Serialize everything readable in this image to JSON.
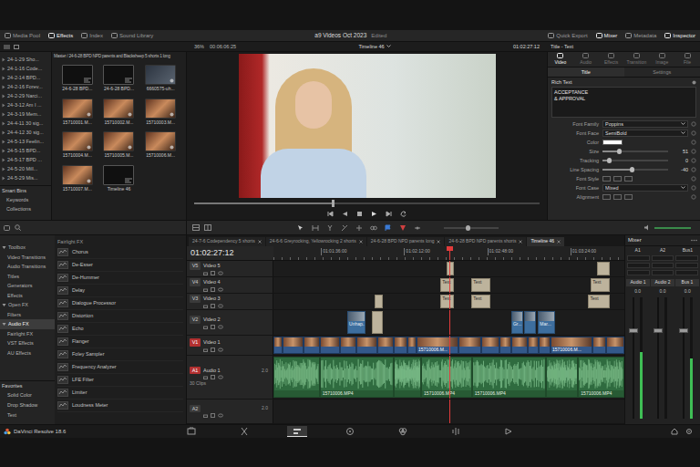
{
  "topbar": {
    "left": [
      {
        "label": "Media Pool",
        "selected": false
      },
      {
        "label": "Effects",
        "selected": true
      },
      {
        "label": "Index",
        "selected": false
      },
      {
        "label": "Sound Library",
        "selected": false
      }
    ],
    "project": "a9 Videos Oct 2023",
    "status": "Edited",
    "right": [
      {
        "label": "Quick Export",
        "selected": false
      },
      {
        "label": "Mixer",
        "selected": true
      },
      {
        "label": "Metadata",
        "selected": false
      },
      {
        "label": "Inspector",
        "selected": true
      }
    ]
  },
  "subbar": {
    "zoom": "36%",
    "duration": "00:06:06:25",
    "timeline": "Timeline 46",
    "timecode": "01:02:27:12",
    "inspector_title": "Title - Text"
  },
  "bins": {
    "items": [
      "24-1-29 Sho...",
      "24-1-16 Code...",
      "24-2-14 BPD...",
      "24-2-16 Forev...",
      "24-2-29 Narci...",
      "24-3-12 Am I ...",
      "24-3-19 Mem...",
      "24-4-11 30 sig...",
      "24-4-12 30 sig...",
      "24-5-13 Feelin...",
      "24-5-15 BPD...",
      "24-5-17 BPD ...",
      "24-5-20 Mill...",
      "24-5-29 Mis..."
    ],
    "smart_title": "Smart Bins",
    "smart_items": [
      "Keywords",
      "Collections"
    ]
  },
  "media_pool": {
    "path": "Master / 24-6-28 BPD NPD parents and Blacksheep 5 shorts 1 long",
    "clips": [
      {
        "label": "24-6-28 BPD...",
        "kind": "timeline"
      },
      {
        "label": "24-6-28 BPD...",
        "kind": "timeline"
      },
      {
        "label": "6660575-uh...",
        "kind": "stock"
      },
      {
        "label": "15710001.M...",
        "kind": "clip"
      },
      {
        "label": "15710002.M...",
        "kind": "clip"
      },
      {
        "label": "15710003.M...",
        "kind": "clip"
      },
      {
        "label": "15710004.M...",
        "kind": "clip"
      },
      {
        "label": "15710005.M...",
        "kind": "clip"
      },
      {
        "label": "15710006.M...",
        "kind": "clip"
      },
      {
        "label": "15710007.M...",
        "kind": "clip"
      },
      {
        "label": "Timeline 46",
        "kind": "timeline"
      }
    ]
  },
  "viewer": {
    "scrub_level": 0.4
  },
  "inspector": {
    "tabs": [
      {
        "label": "Video",
        "selected": true
      },
      {
        "label": "Audio",
        "selected": false
      },
      {
        "label": "Effects",
        "selected": false
      },
      {
        "label": "Transition",
        "selected": false
      },
      {
        "label": "Image",
        "selected": false
      },
      {
        "label": "File",
        "selected": false
      }
    ],
    "subtabs": [
      {
        "label": "Title",
        "selected": true
      },
      {
        "label": "Settings",
        "selected": false
      }
    ],
    "section": "Rich Text",
    "text": "ACCEPTANCE\n& APPROVAL",
    "props": [
      {
        "label": "Font Family",
        "kind": "select",
        "value": "Poppins"
      },
      {
        "label": "Font Face",
        "kind": "select",
        "value": "SemiBold"
      },
      {
        "label": "Color",
        "kind": "color",
        "color": "#ffffff"
      },
      {
        "label": "Size",
        "kind": "slider",
        "value": "51",
        "level": 0.25
      },
      {
        "label": "Tracking",
        "kind": "slider",
        "value": "0",
        "level": 0.1
      },
      {
        "label": "Line Spacing",
        "kind": "slider",
        "value": "-40",
        "level": 0.45
      },
      {
        "label": "Font Style",
        "kind": "buttons"
      },
      {
        "label": "Font Case",
        "kind": "select",
        "value": "Mixed"
      },
      {
        "label": "Alignment",
        "kind": "buttons"
      }
    ]
  },
  "effects": {
    "categories": [
      {
        "label": "Toolbox",
        "kind": "group",
        "expanded": true,
        "selected": false
      },
      {
        "label": "Video Transitions",
        "kind": "item",
        "selected": false
      },
      {
        "label": "Audio Transitions",
        "kind": "item",
        "selected": false
      },
      {
        "label": "Titles",
        "kind": "item",
        "selected": false
      },
      {
        "label": "Generators",
        "kind": "item",
        "selected": false
      },
      {
        "label": "Effects",
        "kind": "item",
        "selected": false
      },
      {
        "label": "Open FX",
        "kind": "group",
        "expanded": true,
        "selected": false
      },
      {
        "label": "Filters",
        "kind": "item",
        "selected": false
      },
      {
        "label": "Audio FX",
        "kind": "group",
        "expanded": true,
        "selected": true
      },
      {
        "label": "Fairlight FX",
        "kind": "item",
        "selected": false
      },
      {
        "label": "VST Effects",
        "kind": "item",
        "selected": false
      },
      {
        "label": "AU Effects",
        "kind": "item",
        "selected": false
      }
    ],
    "favorites_title": "Favorites",
    "favorites": [
      "Solid Color",
      "Drop Shadow",
      "Text"
    ],
    "list_title": "Fairlight FX",
    "list": [
      "Chorus",
      "De-Esser",
      "De-Hummer",
      "Delay",
      "Dialogue Processor",
      "Distortion",
      "Echo",
      "Flanger",
      "Foley Sampler",
      "Frequency Analyzer",
      "LFE Filter",
      "Limiter",
      "Loudness Meter"
    ]
  },
  "timeline": {
    "tabs": [
      {
        "label": "24-7-6 Codependency 5 shorts",
        "selected": false
      },
      {
        "label": "24-6-6 Greyrocking, Yellowrocking 2 shorts",
        "selected": false
      },
      {
        "label": "24-6-28 BPD NPD parents long",
        "selected": false
      },
      {
        "label": "24-6-28 BPD NPD parents shorts",
        "selected": false
      },
      {
        "label": "Timeline 46",
        "selected": true
      }
    ],
    "timecode": "01:02:27:12",
    "span_s": 152,
    "playhead_s": 76,
    "ruler": [
      {
        "label": "01:01:36:00",
        "at": 20.6
      },
      {
        "label": "01:02:12:00",
        "at": 56.6
      },
      {
        "label": "01:02:48:00",
        "at": 92.6
      },
      {
        "label": "01:03:24:00",
        "at": 128.6
      }
    ],
    "tracks": [
      {
        "id": "V5",
        "name": "Video 5",
        "kind": "video",
        "selected": false,
        "clips": [
          {
            "start": 75,
            "end": 78.3,
            "kind": "title"
          },
          {
            "start": 140,
            "end": 145.5,
            "kind": "title"
          }
        ]
      },
      {
        "id": "V4",
        "name": "Video 4",
        "kind": "video",
        "selected": false,
        "clips": [
          {
            "start": 72.3,
            "end": 78.3,
            "kind": "title",
            "label": "Text"
          },
          {
            "start": 85.8,
            "end": 94,
            "kind": "title",
            "label": "Text"
          },
          {
            "start": 137.5,
            "end": 145.5,
            "kind": "title",
            "label": "Text"
          }
        ]
      },
      {
        "id": "V3",
        "name": "Video 3",
        "kind": "video",
        "selected": false,
        "clips": [
          {
            "start": 43.9,
            "end": 47.4,
            "kind": "title"
          },
          {
            "start": 72.3,
            "end": 78.3,
            "kind": "title",
            "label": "Text"
          },
          {
            "start": 85.8,
            "end": 94,
            "kind": "title",
            "label": "Text"
          },
          {
            "start": 136.4,
            "end": 145.5,
            "kind": "title",
            "label": "Text"
          }
        ]
      },
      {
        "id": "V2",
        "name": "Video 2",
        "kind": "video",
        "selected": false,
        "clips": [
          {
            "start": 32,
            "end": 40,
            "kind": "video",
            "label": "Unhap..."
          },
          {
            "start": 42.7,
            "end": 47.4,
            "kind": "title"
          },
          {
            "start": 103,
            "end": 108,
            "kind": "video",
            "label": "Gr..."
          },
          {
            "start": 108.7,
            "end": 113.8,
            "kind": "video"
          },
          {
            "start": 114.6,
            "end": 122,
            "kind": "video",
            "label": "Mar..."
          }
        ]
      },
      {
        "id": "V1",
        "name": "Video 1",
        "kind": "video",
        "selected": true,
        "clips": [
          {
            "start": 0,
            "end": 4,
            "kind": "main"
          },
          {
            "start": 4,
            "end": 13,
            "kind": "main"
          },
          {
            "start": 13,
            "end": 20,
            "kind": "main"
          },
          {
            "start": 20,
            "end": 29,
            "kind": "main"
          },
          {
            "start": 29,
            "end": 36,
            "kind": "main"
          },
          {
            "start": 36,
            "end": 45,
            "kind": "main"
          },
          {
            "start": 45,
            "end": 52,
            "kind": "main"
          },
          {
            "start": 52,
            "end": 58,
            "kind": "main"
          },
          {
            "start": 58,
            "end": 62,
            "kind": "main"
          },
          {
            "start": 62,
            "end": 80,
            "kind": "main",
            "label": "15710006.M..."
          },
          {
            "start": 80,
            "end": 90,
            "kind": "main"
          },
          {
            "start": 90,
            "end": 98,
            "kind": "main"
          },
          {
            "start": 98,
            "end": 103,
            "kind": "main"
          },
          {
            "start": 103,
            "end": 110,
            "kind": "main"
          },
          {
            "start": 110,
            "end": 115,
            "kind": "main"
          },
          {
            "start": 115,
            "end": 120,
            "kind": "main"
          },
          {
            "start": 120,
            "end": 138,
            "kind": "main",
            "label": "15710006.M..."
          },
          {
            "start": 138,
            "end": 144,
            "kind": "main"
          },
          {
            "start": 144,
            "end": 152,
            "kind": "main"
          }
        ]
      },
      {
        "id": "A1",
        "name": "Audio 1",
        "kind": "audio",
        "channels": "2.0",
        "count": "30 Clips",
        "selected": true,
        "clips": [
          {
            "start": 0,
            "end": 20,
            "kind": "audio"
          },
          {
            "start": 20,
            "end": 52,
            "kind": "audio",
            "label": "15710006.MP4"
          },
          {
            "start": 52,
            "end": 64,
            "kind": "audio"
          },
          {
            "start": 64,
            "end": 86,
            "kind": "audio",
            "label": "15710006.MP4"
          },
          {
            "start": 86,
            "end": 118,
            "kind": "audio",
            "label": "15710006.MP4"
          },
          {
            "start": 118,
            "end": 132,
            "kind": "audio"
          },
          {
            "start": 132,
            "end": 152,
            "kind": "audio",
            "label": "15710006.MP4"
          }
        ]
      },
      {
        "id": "A2",
        "kind": "audio",
        "channels": "2.0",
        "selected": false,
        "clips": []
      }
    ]
  },
  "mixer": {
    "title": "Mixer",
    "channels": [
      {
        "id": "A1",
        "name": "Audio 1",
        "reading": "0.0",
        "level": 0.72,
        "meter": 0.55
      },
      {
        "id": "A2",
        "name": "Audio 2",
        "reading": "0.0",
        "level": 0.72,
        "meter": 0.0
      },
      {
        "id": "Bus1",
        "name": "Bus 1",
        "reading": "0.0",
        "level": 0.72,
        "meter": 0.5
      }
    ]
  },
  "bottombar": {
    "app": "DaVinci Resolve 18.6",
    "pages": [
      {
        "selected": false
      },
      {
        "selected": false
      },
      {
        "selected": true
      },
      {
        "selected": false
      },
      {
        "selected": false
      },
      {
        "selected": false
      },
      {
        "selected": false
      }
    ]
  }
}
